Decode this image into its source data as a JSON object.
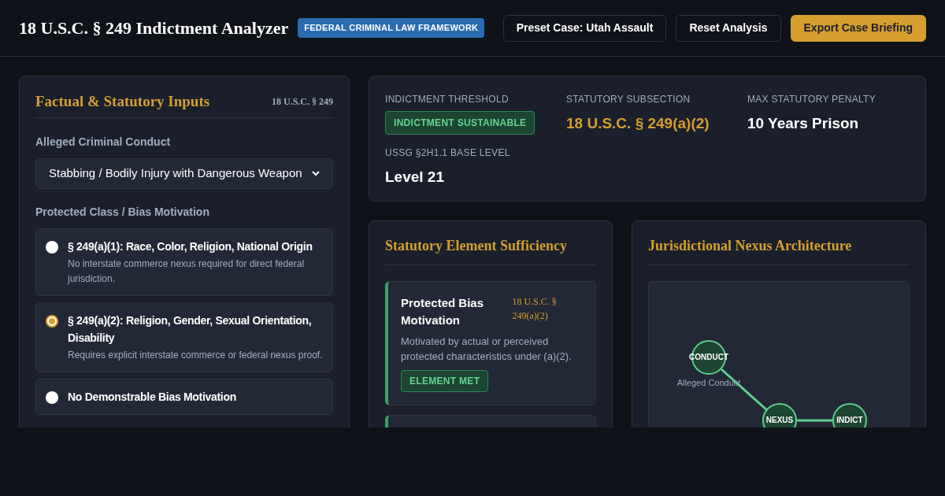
{
  "header": {
    "title": "18 U.S.C. § 249 Indictment Analyzer",
    "badge": "FEDERAL CRIMINAL LAW FRAMEWORK",
    "buttons": [
      {
        "label": "Preset Case: Utah Assault",
        "kind": "outline"
      },
      {
        "label": "Reset Analysis",
        "kind": "outline"
      },
      {
        "label": "Export Case Briefing",
        "kind": "primary"
      }
    ]
  },
  "inputs": {
    "title": "Factual & Statutory Inputs",
    "citation": "18 U.S.C. § 249",
    "conduct_label": "Alleged Criminal Conduct",
    "conduct_value": "Stabbing / Bodily Injury with Dangerous Weapon",
    "bias_label": "Protected Class / Bias Motivation",
    "options": [
      {
        "title": "§ 249(a)(1): Race, Color, Religion, National Origin",
        "description": "No interstate commerce nexus required for direct federal jurisdiction.",
        "selected": false
      },
      {
        "title": "§ 249(a)(2): Religion, Gender, Sexual Orientation, Disability",
        "description": "Requires explicit interstate commerce or federal nexus proof.",
        "selected": true
      },
      {
        "title": "No Demonstrable Bias Motivation",
        "selected": false
      }
    ]
  },
  "summary": {
    "metrics": [
      {
        "label": "INDICTMENT THRESHOLD",
        "value": "INDICTMENT SUSTAINABLE",
        "kind": "badge"
      },
      {
        "label": "STATUTORY SUBSECTION",
        "value": "18 U.S.C. § 249(a)(2)",
        "kind": "accent"
      },
      {
        "label": "MAX STATUTORY PENALTY",
        "value": "10 Years Prison",
        "kind": "plain"
      },
      {
        "label": "USSG §2H1.1 BASE LEVEL",
        "value": "Level 21",
        "kind": "plain"
      }
    ]
  },
  "elements": {
    "title": "Statutory Element Sufficiency",
    "items": [
      {
        "name": "Protected Bias Motivation",
        "citation": "18 U.S.C. § 249(a)(2)",
        "description": "Motivated by actual or perceived protected characteristics under (a)(2).",
        "status": "ELEMENT MET",
        "met": true
      },
      {
        "met": true
      }
    ]
  },
  "nexus": {
    "title": "Jurisdictional Nexus Architecture",
    "nodes": [
      {
        "label": "CONDUCT",
        "caption": "Alleged Conduct"
      },
      {
        "label": "NEXUS"
      },
      {
        "label": "INDICT"
      }
    ]
  }
}
